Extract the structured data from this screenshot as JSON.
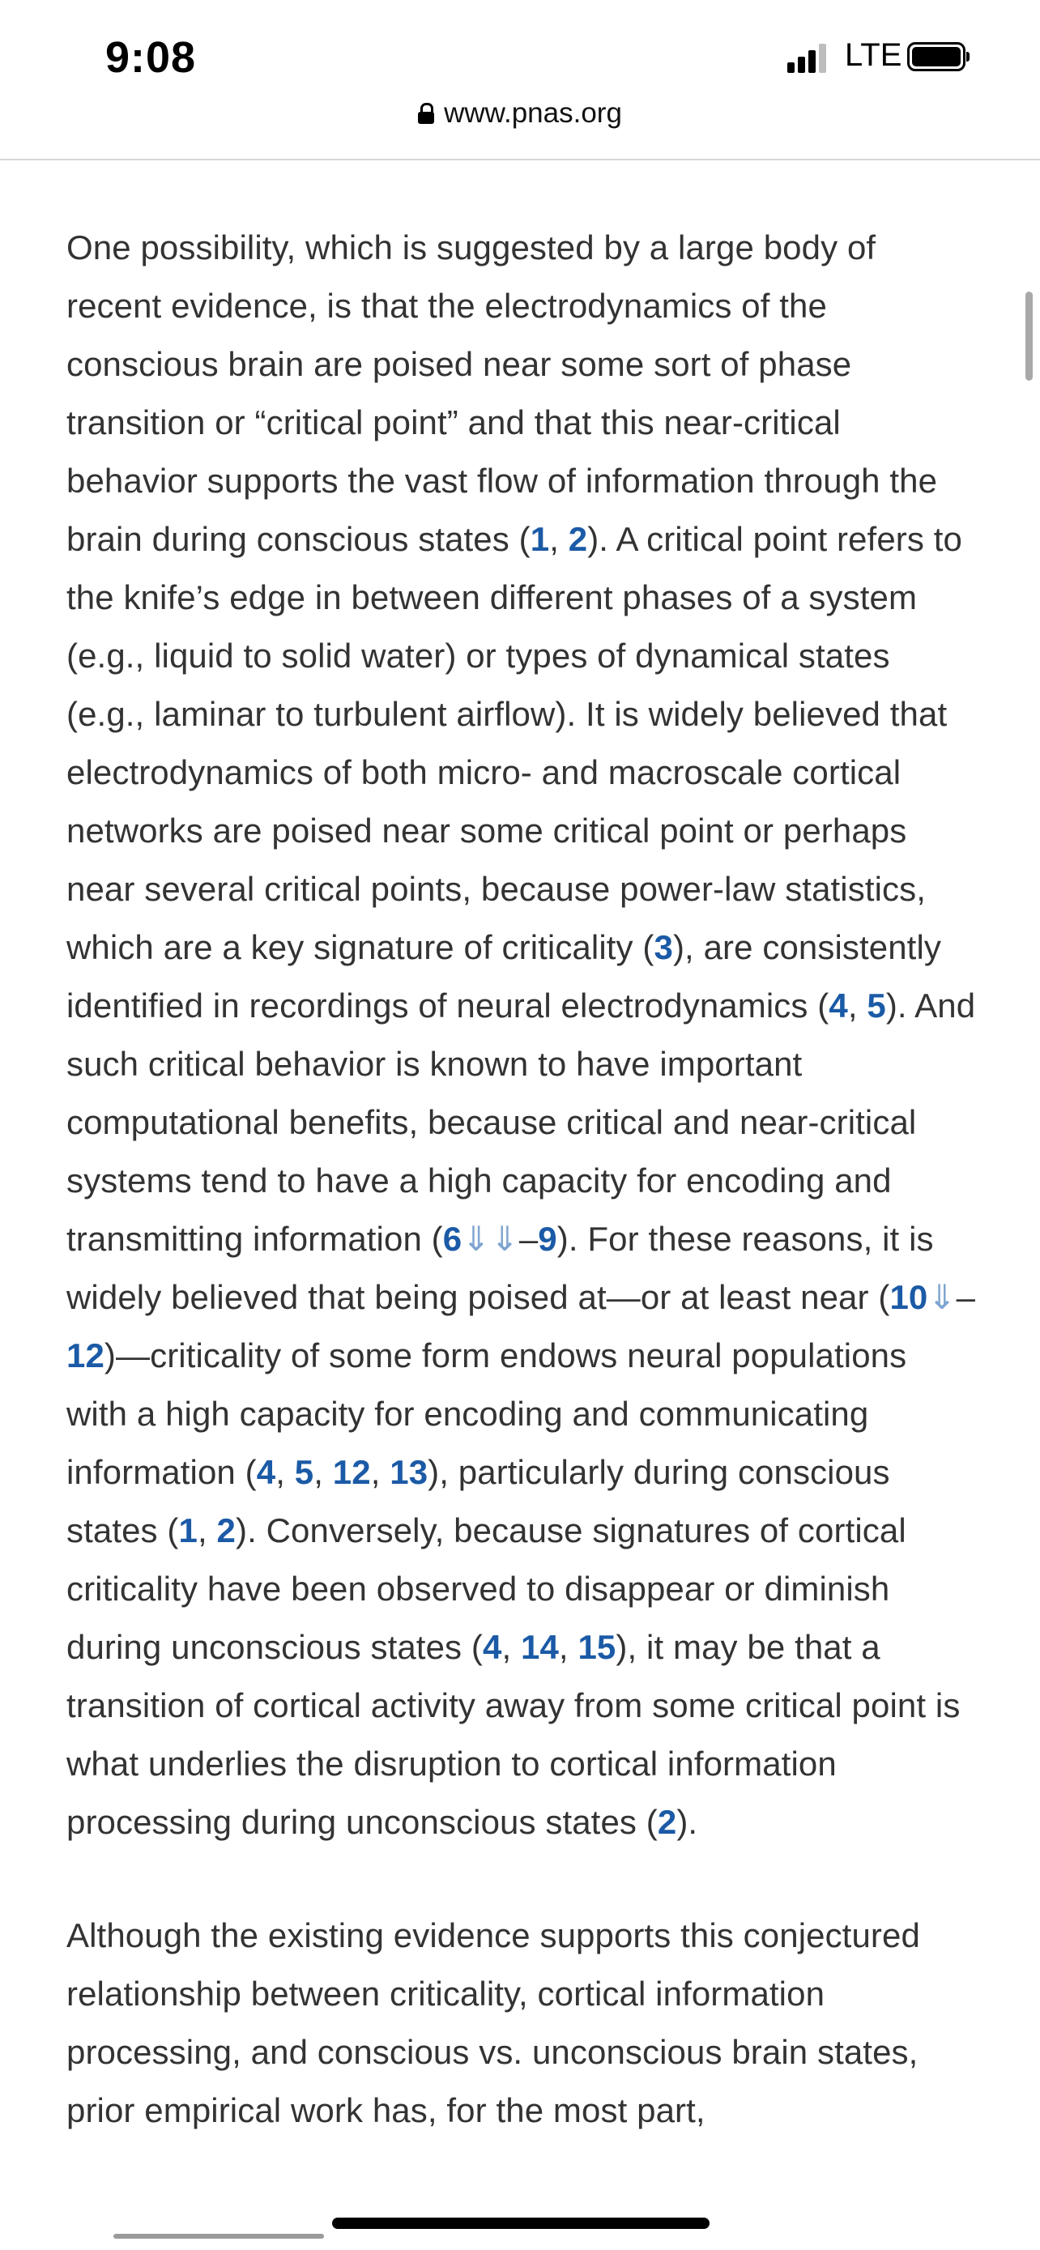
{
  "status_bar": {
    "time": "9:08",
    "network": "LTE",
    "signal_bars": 4,
    "signal_active_bars": 3,
    "battery_level": 1.0
  },
  "url_bar": {
    "url": "www.pnas.org"
  },
  "article": {
    "paragraph1": [
      {
        "t": "One possibility, which is suggested by a large body of recent evidence, is that the electrodynamics of the conscious brain are poised near some sort of phase transition or “critical point” and that this near-critical behavior supports the vast flow of information through the brain during conscious states ("
      },
      {
        "r": "1"
      },
      {
        "t": ", "
      },
      {
        "r": "2"
      },
      {
        "t": "). A critical point refers to the knife’s edge in between different phases of a system (e.g., liquid to solid water) or types of dynamical states (e.g., laminar to turbulent airflow). It is widely believed that electrodynamics of both micro- and macroscale cortical networks are poised near some critical point or perhaps near several critical points, because power-law statistics, which are a key signature of criticality ("
      },
      {
        "r": "3"
      },
      {
        "t": "), are consistently identified in recordings of neural electrodynamics ("
      },
      {
        "r": "4"
      },
      {
        "t": ", "
      },
      {
        "r": "5"
      },
      {
        "t": "). And such critical behavior is known to have important computational benefits, because critical and near-critical systems tend to have a high capacity for encoding and transmitting information ("
      },
      {
        "r": "6"
      },
      {
        "m": "⇓⇓"
      },
      {
        "t": "–"
      },
      {
        "r": "9"
      },
      {
        "t": "). For these reasons, it is widely believed that being poised at—or at least near ("
      },
      {
        "r": "10"
      },
      {
        "m": "⇓"
      },
      {
        "t": "–"
      },
      {
        "r": "12"
      },
      {
        "t": ")—criticality of some form endows neural populations with a high capacity for encoding and communicating information ("
      },
      {
        "r": "4"
      },
      {
        "t": ", "
      },
      {
        "r": "5"
      },
      {
        "t": ", "
      },
      {
        "r": "12"
      },
      {
        "t": ", "
      },
      {
        "r": "13"
      },
      {
        "t": "), particularly during conscious states ("
      },
      {
        "r": "1"
      },
      {
        "t": ", "
      },
      {
        "r": "2"
      },
      {
        "t": "). Conversely, because signatures of cortical criticality have been observed to disappear or diminish during unconscious states ("
      },
      {
        "r": "4"
      },
      {
        "t": ", "
      },
      {
        "r": "14"
      },
      {
        "t": ", "
      },
      {
        "r": "15"
      },
      {
        "t": "), it may be that a transition of cortical activity away from some critical point is what underlies the disruption to cortical information processing during unconscious states ("
      },
      {
        "r": "2"
      },
      {
        "t": ")."
      }
    ],
    "paragraph2": "Although the existing evidence supports this conjectured relationship between criticality, cortical information processing, and conscious vs. unconscious brain states, prior empirical work has, for the most part,"
  },
  "colors": {
    "text": "#333333",
    "reference_link": "#1b5aa6",
    "range_mark": "#7fa4d0"
  }
}
